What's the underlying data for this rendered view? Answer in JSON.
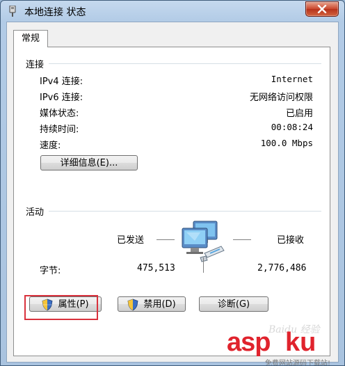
{
  "window": {
    "title": "本地连接 状态"
  },
  "tabs": [
    {
      "label": "常规"
    }
  ],
  "connection": {
    "title": "连接",
    "rows": [
      {
        "label": "IPv4 连接:",
        "value": "Internet"
      },
      {
        "label": "IPv6 连接:",
        "value": "无网络访问权限"
      },
      {
        "label": "媒体状态:",
        "value": "已启用"
      },
      {
        "label": "持续时间:",
        "value": "00:08:24"
      },
      {
        "label": "速度:",
        "value": "100.0 Mbps"
      }
    ],
    "details_button": "详细信息(E)..."
  },
  "activity": {
    "title": "活动",
    "sent_label": "已发送",
    "received_label": "已接收",
    "bytes_label": "字节:",
    "bytes_sent": "475,513",
    "bytes_received": "2,776,486"
  },
  "buttons": {
    "properties": "属性(P)",
    "disable": "禁用(D)",
    "diagnose": "诊断(G)"
  },
  "watermark": {
    "brand_a": "asp",
    "brand_b": "ku",
    "subtitle": "免费网站源码下载站!",
    "faint": "Baidu 经验"
  },
  "colors": {
    "highlight_border": "#d9313c",
    "close_button": "#c9462c",
    "watermark_red": "#e0232d"
  }
}
